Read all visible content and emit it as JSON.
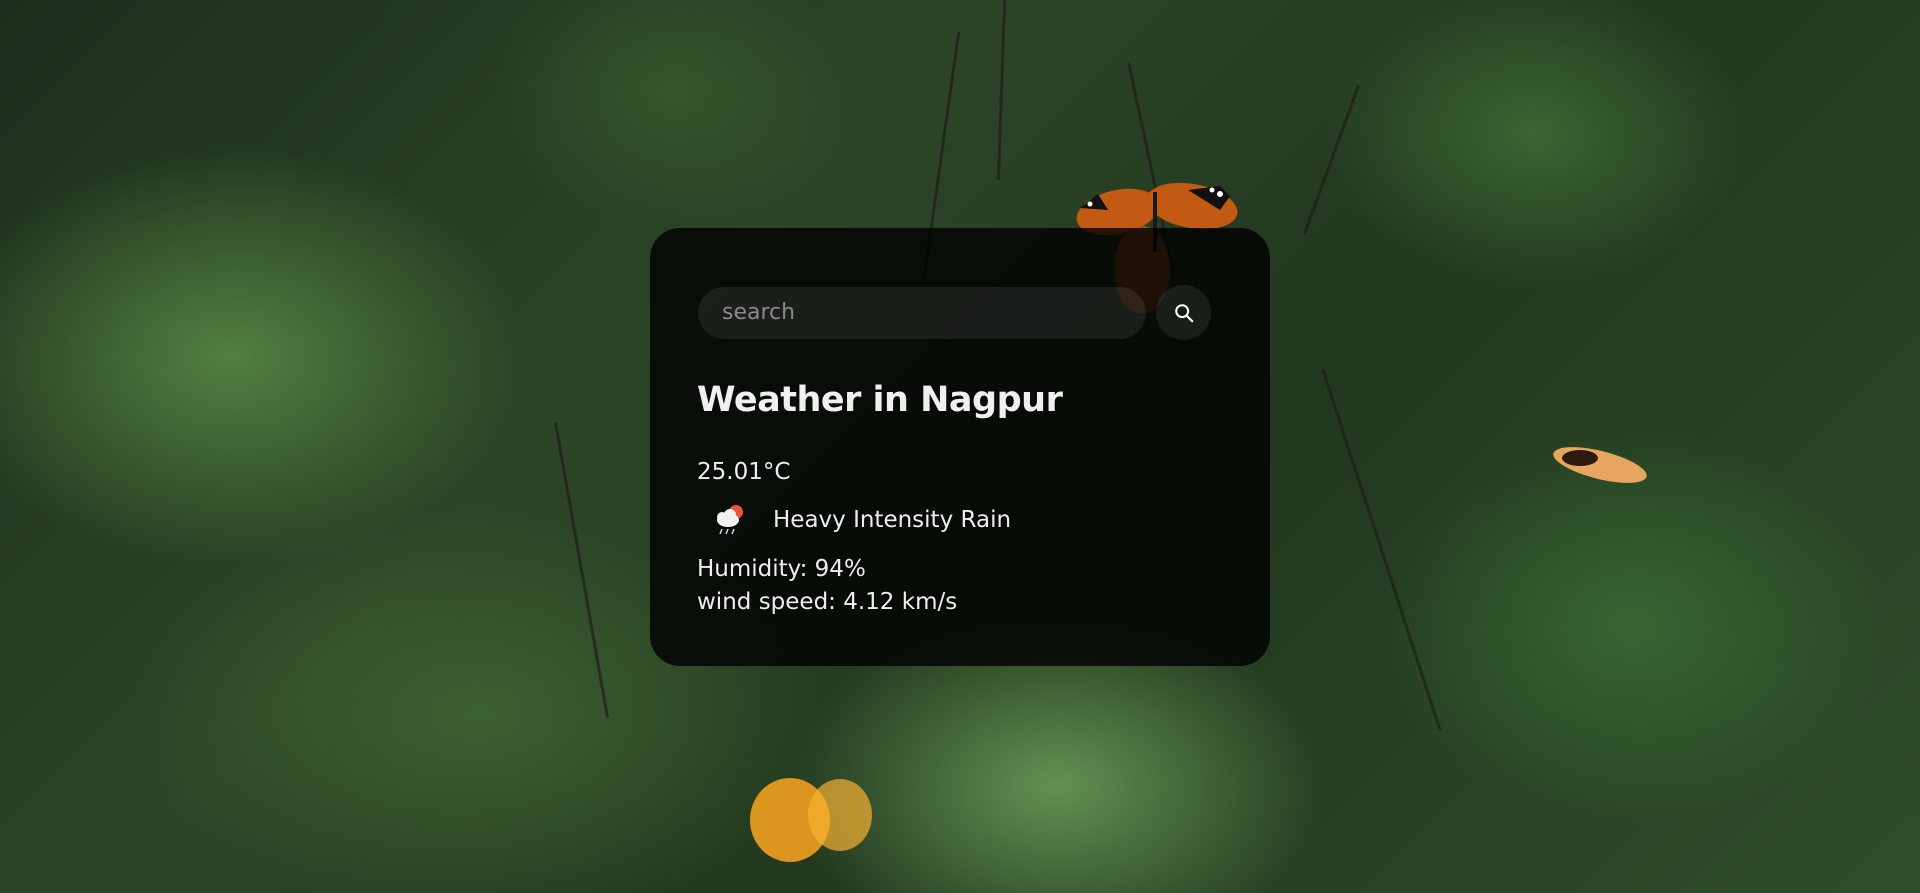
{
  "search": {
    "placeholder": "search",
    "value": "",
    "button_icon": "search-icon"
  },
  "weather": {
    "title": "Weather in Nagpur",
    "temperature": "25.01°C",
    "icon": "rain-cloud-sun-icon",
    "description": "Heavy Intensity Rain",
    "humidity": "Humidity: 94%",
    "wind_speed": "wind speed: 4.12 km/s"
  },
  "colors": {
    "card_background": "#000000",
    "text": "#eeeeee",
    "input_background": "#7c7c7c",
    "placeholder": "#8a8a8a"
  },
  "background": {
    "description_icon": "forest-butterflies-background"
  }
}
